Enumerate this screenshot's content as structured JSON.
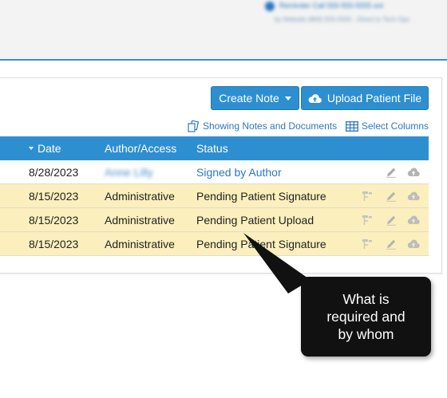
{
  "header": {
    "blurred_line1": "Reminder   Call 555-555-5555 ext",
    "blurred_line2": "by Website  (800) 555-5555 - Direct to Tech Ops"
  },
  "toolbar": {
    "create_note_label": "Create Note",
    "upload_label": "Upload Patient File"
  },
  "subbar": {
    "notes_label": "Showing Notes and Documents",
    "columns_label": "Select Columns"
  },
  "table": {
    "columns": {
      "date": "Date",
      "author": "Author/Access",
      "status": "Status"
    },
    "rows": [
      {
        "date": "8/28/2023",
        "author": "Anne Lilly",
        "status": "Signed by Author"
      },
      {
        "date": "8/15/2023",
        "author": "Administrative",
        "status": "Pending Patient Signature"
      },
      {
        "date": "8/15/2023",
        "author": "Administrative",
        "status": "Pending Patient Upload"
      },
      {
        "date": "8/15/2023",
        "author": "Administrative",
        "status": "Pending Patient Signature"
      }
    ]
  },
  "callout": {
    "line1": "What is",
    "line2": "required and",
    "line3": "by whom"
  },
  "icons": {
    "flow": "workflow-icon",
    "edit": "pencil-icon",
    "cloud": "cloud-upload-icon"
  },
  "colors": {
    "accent": "#2e8fd0",
    "row_highlight": "#fbefbd",
    "link": "#2b78c0",
    "callout_bg": "#111111"
  }
}
